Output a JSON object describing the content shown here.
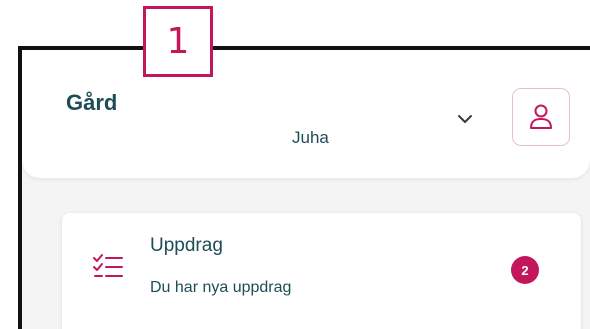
{
  "callout": {
    "number": "1"
  },
  "header": {
    "title": "Gård",
    "user_name": "Juha",
    "chevron_icon": "chevron-down-icon",
    "profile_icon": "user-icon"
  },
  "tasks_card": {
    "icon": "checklist-icon",
    "title": "Uppdrag",
    "subtitle": "Du har nya uppdrag",
    "badge_count": "2"
  },
  "colors": {
    "accent": "#c2185b",
    "text": "#1d4d57",
    "background": "#f4f4f5"
  }
}
